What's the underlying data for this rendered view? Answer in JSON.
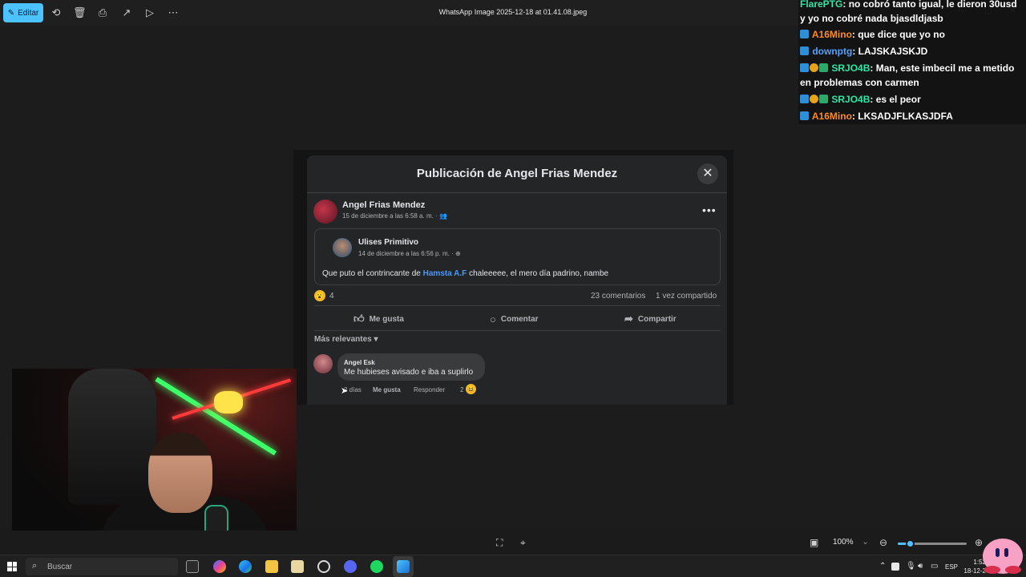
{
  "viewer": {
    "edit_label": "Editar",
    "file_title": "WhatsApp Image 2025-12-18 at 01.41.08.jpeg",
    "zoom": "100%",
    "zoom_level": 0.17
  },
  "chat": {
    "messages": [
      {
        "user": "FlarePTG",
        "text": ": no cobró tanto igual, le dieron 30usd y yo no cobré nada bjasdldjasb",
        "color": "#2ee6a8",
        "badges": []
      },
      {
        "user": "A16Mino",
        "text": ": que dice que yo no",
        "color": "#ff8a1f",
        "badges": [
          "blue"
        ]
      },
      {
        "user": "downptg",
        "text": ": LAJSKAJSKJD",
        "color": "#4fa3ff",
        "badges": [
          "blue"
        ]
      },
      {
        "user": "SRJO4B",
        "text": ": Man, este imbecil me a metido en problemas con carmen",
        "color": "#2ee6a8",
        "badges": [
          "blue",
          "gold",
          "green"
        ]
      },
      {
        "user": "SRJO4B",
        "text": ": es el peor",
        "color": "#2ee6a8",
        "badges": [
          "blue",
          "gold",
          "green"
        ]
      },
      {
        "user": "A16Mino",
        "text": ": LKSADJFLKASJDFA",
        "color": "#ff8a1f",
        "badges": [
          "blue"
        ]
      }
    ]
  },
  "modal": {
    "title": "Publicación de Angel Frias Mendez",
    "post": {
      "author": "Angel Frias Mendez",
      "date": "15 de diciembre a las 6:58 a. m. ·",
      "shared": {
        "author": "Ulises Primitivo",
        "date": "14 de diciembre a las 6:56 p. m. ·",
        "text_before": "Que puto el contrincante de ",
        "mention": "Hamsta A.F",
        "text_after": " chaleeeee, el mero día padrino, nambe"
      },
      "reactions": "4",
      "comments": "23 comentarios",
      "shares": "1 vez compartido"
    },
    "actions": {
      "like": "Me gusta",
      "comment": "Comentar",
      "share": "Compartir"
    },
    "sort_label": "Más relevantes",
    "comment": {
      "author": "Angel Esk",
      "text": "Me hubieses avisado e iba a suplirlo",
      "age": "2 días",
      "like": "Me gusta",
      "reply": "Responder",
      "reaction_count": "2"
    }
  },
  "taskbar": {
    "search_placeholder": "Buscar",
    "language": "ESP",
    "time": "1:52",
    "date": "18-12-2"
  },
  "colors": {
    "accent": "#4cc2ff",
    "fb_link": "#4599ff"
  }
}
